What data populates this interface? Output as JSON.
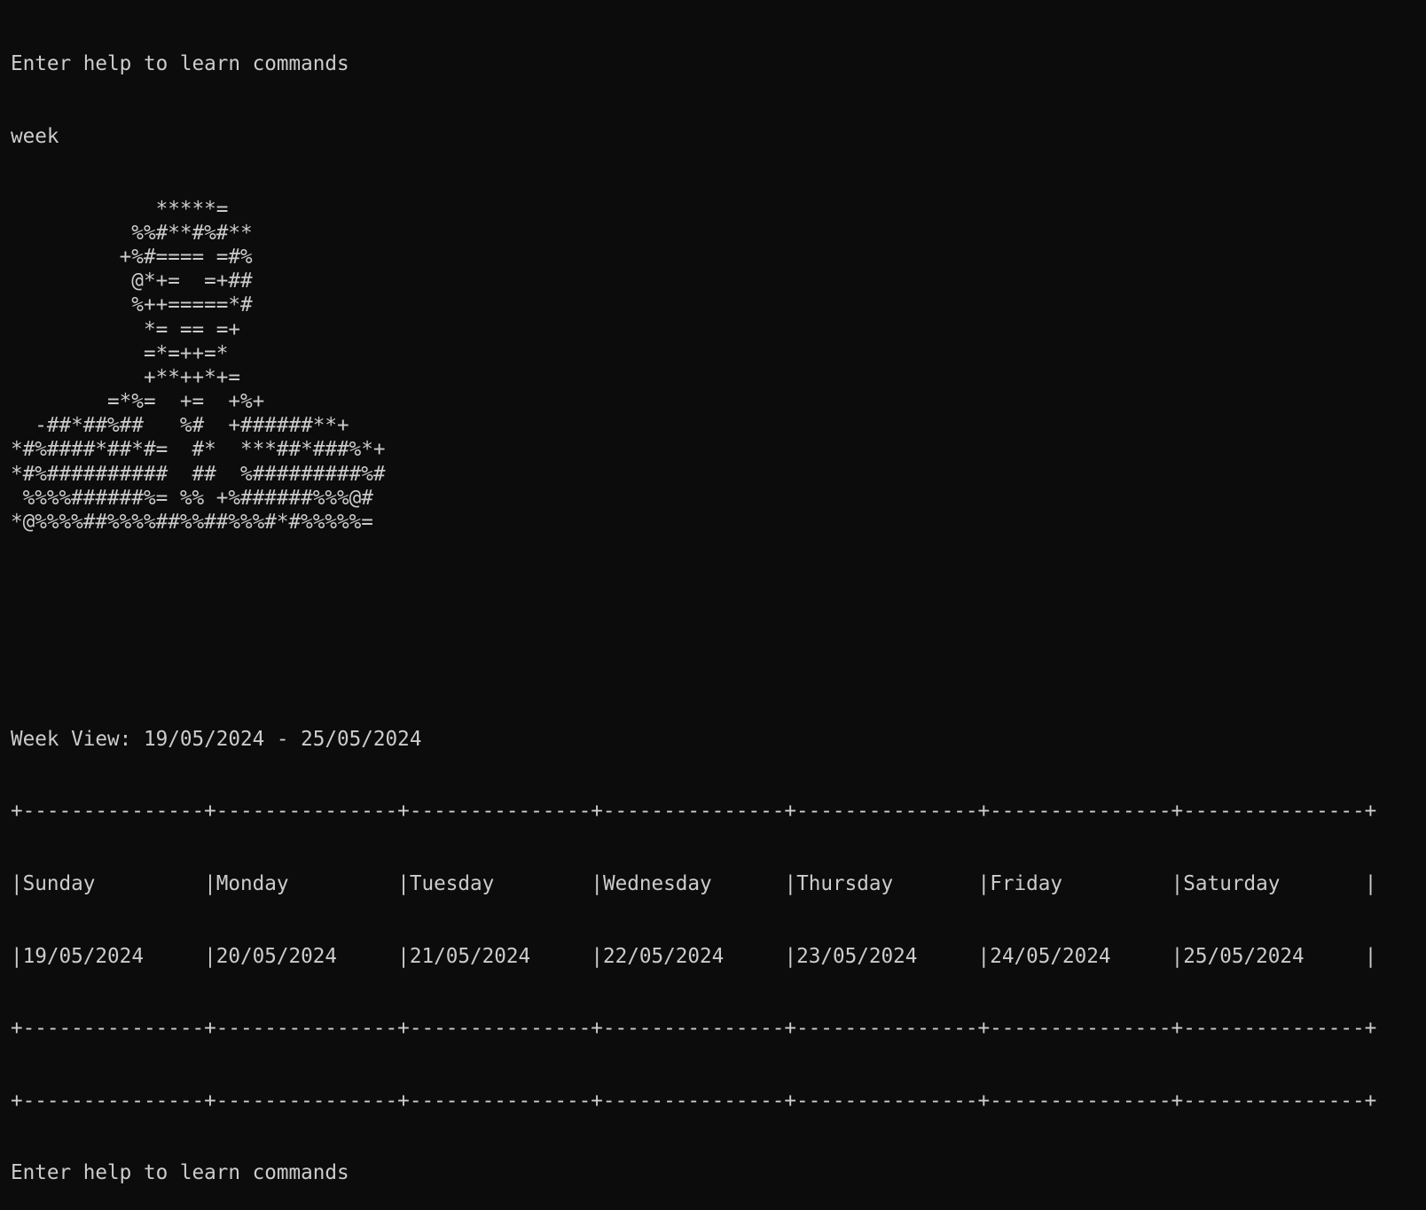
{
  "terminal": {
    "prompt_top": "Enter help to learn commands",
    "command": "week",
    "ascii_art": [
      "            *****=",
      "          %%#**#%#**",
      "         +%#==== =#%",
      "          @*+=  =+##",
      "          %++=====*#",
      "           *= == =+",
      "           =*=++=*",
      "           +**++*+=",
      "        =*%=  +=  +%+",
      "  -##*##%##   %#  +######**+",
      "*#%####*##*#=  #*  ***##*###%*+",
      "*#%##########  ##  %#########%#",
      " %%%%######%= %% +%######%%%@#",
      "*@%%%%##%%%%##%%##%%%#*#%%%%%="
    ],
    "week_view_title": "Week View: 19/05/2024 - 25/05/2024",
    "table_border": "+---------------+---------------+---------------+---------------+---------------+---------------+---------------+",
    "days": [
      {
        "name": "Sunday",
        "date": "19/05/2024"
      },
      {
        "name": "Monday",
        "date": "20/05/2024"
      },
      {
        "name": "Tuesday",
        "date": "21/05/2024"
      },
      {
        "name": "Wednesday",
        "date": "22/05/2024"
      },
      {
        "name": "Thursday",
        "date": "23/05/2024"
      },
      {
        "name": "Friday",
        "date": "24/05/2024"
      },
      {
        "name": "Saturday",
        "date": "25/05/2024"
      }
    ],
    "prompt_bottom": "Enter help to learn commands",
    "colors": {
      "background": "#0c0c0c",
      "foreground": "#cccccc"
    }
  }
}
